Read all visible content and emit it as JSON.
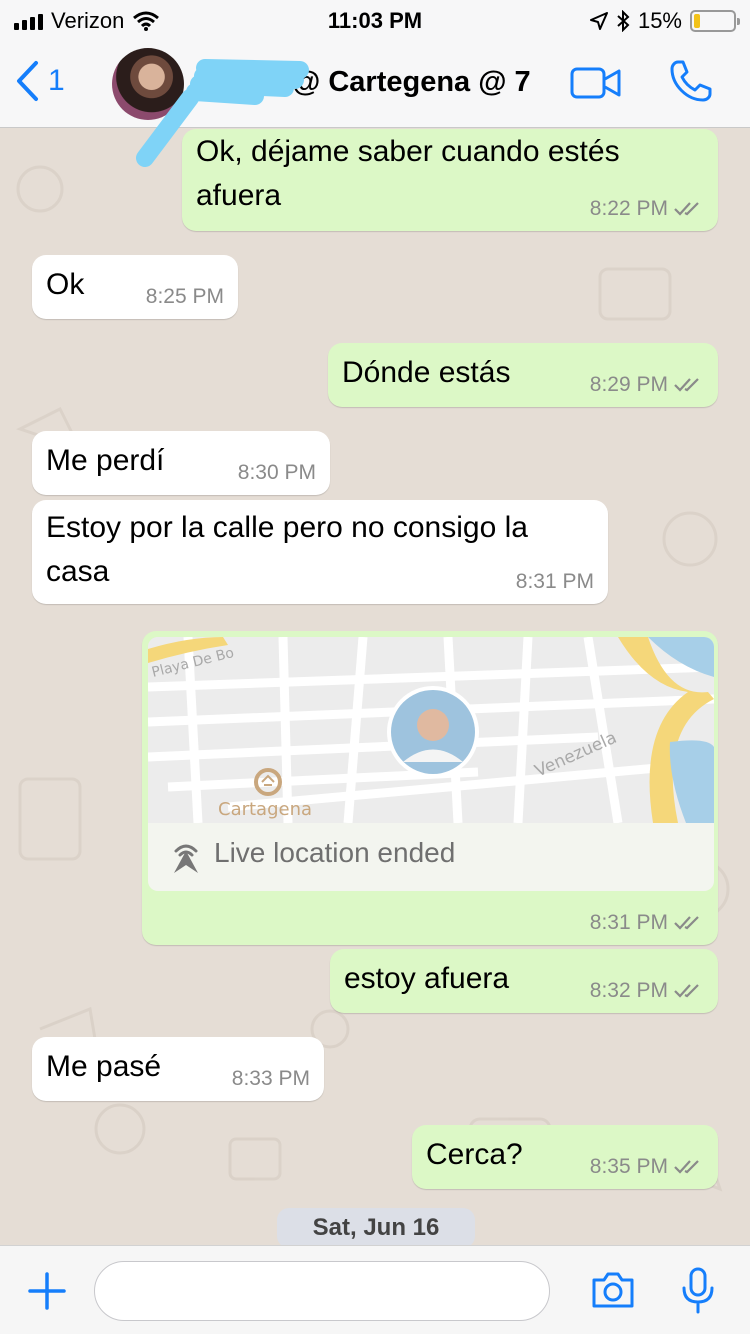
{
  "status": {
    "carrier": "Verizon",
    "time": "11:03 PM",
    "battery": "15%",
    "battery_level": 0.15
  },
  "header": {
    "back_count": "1",
    "contact_name": "@ Cartegena @ 7"
  },
  "messages": [
    {
      "dir": "out",
      "lines": [
        "Ok, déjame saber cuando estés",
        "afuera"
      ],
      "time": "8:22 PM",
      "read": true
    },
    {
      "dir": "in",
      "lines": [
        "Ok"
      ],
      "time": "8:25 PM"
    },
    {
      "dir": "out",
      "lines": [
        "Dónde estás"
      ],
      "time": "8:29 PM",
      "read": true
    },
    {
      "dir": "in",
      "lines": [
        "Me perdí"
      ],
      "time": "8:30 PM"
    },
    {
      "dir": "in",
      "lines": [
        "Estoy por la calle pero no consigo la",
        "casa"
      ],
      "time": "8:31 PM"
    },
    {
      "dir": "out",
      "type": "location",
      "time": "8:31 PM",
      "read": true
    },
    {
      "dir": "out",
      "lines": [
        "estoy afuera"
      ],
      "time": "8:32 PM",
      "read": true
    },
    {
      "dir": "in",
      "lines": [
        "Me pasé"
      ],
      "time": "8:33 PM"
    },
    {
      "dir": "out",
      "lines": [
        "Cerca?"
      ],
      "time": "8:35 PM",
      "read": true
    }
  ],
  "location": {
    "status": "Live location ended",
    "map_labels": {
      "street_1": "Playa De Bo",
      "street_2": "Venezuela",
      "poi": "Cartagena"
    }
  },
  "date_separator": "Sat, Jun 16",
  "composer": {
    "text": ""
  },
  "colors": {
    "accent": "#157efb",
    "outgoing_bubble": "#dcf8c6",
    "incoming_bubble": "#ffffff",
    "chat_background": "#e5ddd5",
    "read_ticks": "#8a8a8a"
  },
  "icons": {
    "back": "chevron-left-icon",
    "video": "video-camera-icon",
    "call": "phone-icon",
    "attach": "plus-icon",
    "camera": "camera-icon",
    "mic": "microphone-icon",
    "live_location": "live-location-icon",
    "wifi": "wifi-icon",
    "location_arrow": "location-arrow-icon",
    "bluetooth": "bluetooth-icon"
  }
}
